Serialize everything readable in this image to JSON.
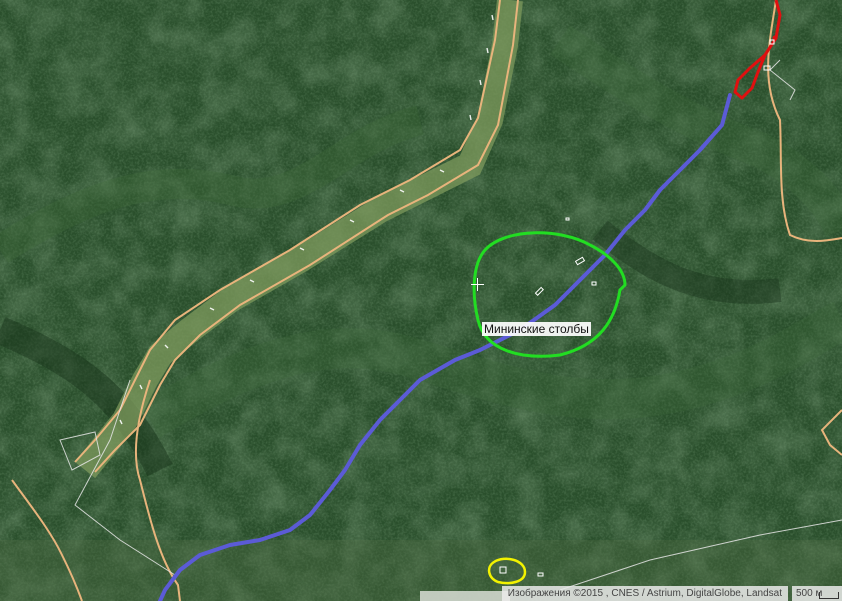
{
  "map": {
    "view": "satellite",
    "place_label": "Мининские столбы",
    "attribution": "Изображения ©2015 , CNES / Astrium, DigitalGlobe, Landsat",
    "scale_label": "500 м",
    "colors": {
      "forest": "#24472a",
      "road": "#e8b47c",
      "route": "#5b5bd6",
      "highlight_green": "#22dd22",
      "highlight_yellow": "#f2f200",
      "track_red": "#e01010",
      "boundary": "#dddddd"
    }
  }
}
